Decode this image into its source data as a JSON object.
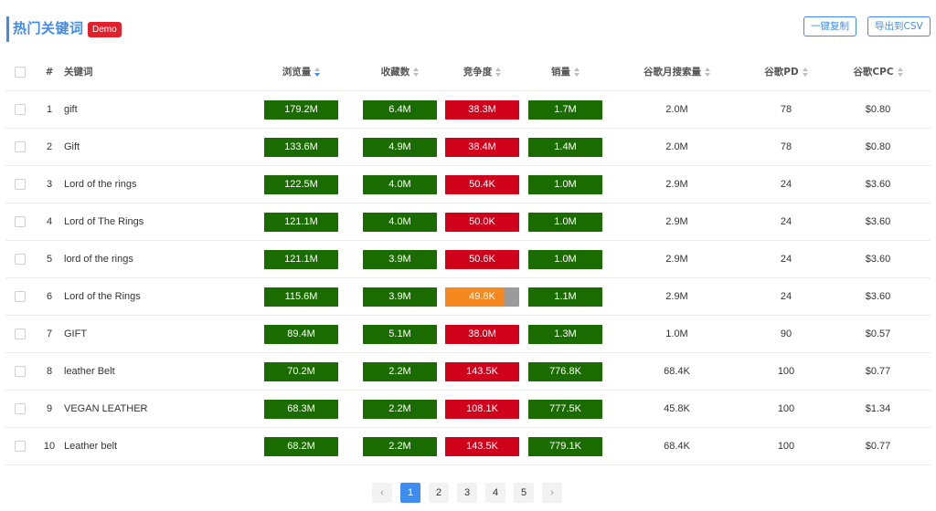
{
  "header": {
    "title": "热门关键词",
    "badge": "Demo",
    "copy_button": "一键复制",
    "export_button": "导出到CSV"
  },
  "columns": {
    "index": "#",
    "keyword": "关键词",
    "views": "浏览量",
    "favorites": "收藏数",
    "competition": "竞争度",
    "sales": "销量",
    "google_monthly": "谷歌月搜索量",
    "google_pd": "谷歌PD",
    "google_cpc": "谷歌CPC"
  },
  "colors": {
    "green": "#1a6b00",
    "red": "#d0021b",
    "orange": "#f5891f",
    "gray": "#9b9b9b",
    "accent": "#3f8cf0"
  },
  "rows": [
    {
      "index": "1",
      "keyword": "gift",
      "views": "179.2M",
      "favorites": "6.4M",
      "competition": "38.3M",
      "competition_color": "red",
      "competition_fill": 1,
      "sales": "1.7M",
      "google_monthly": "2.0M",
      "google_pd": "78",
      "google_cpc": "$0.80"
    },
    {
      "index": "2",
      "keyword": "Gift",
      "views": "133.6M",
      "favorites": "4.9M",
      "competition": "38.4M",
      "competition_color": "red",
      "competition_fill": 1,
      "sales": "1.4M",
      "google_monthly": "2.0M",
      "google_pd": "78",
      "google_cpc": "$0.80"
    },
    {
      "index": "3",
      "keyword": "Lord of the rings",
      "views": "122.5M",
      "favorites": "4.0M",
      "competition": "50.4K",
      "competition_color": "red",
      "competition_fill": 1,
      "sales": "1.0M",
      "google_monthly": "2.9M",
      "google_pd": "24",
      "google_cpc": "$3.60"
    },
    {
      "index": "4",
      "keyword": "Lord of The Rings",
      "views": "121.1M",
      "favorites": "4.0M",
      "competition": "50.0K",
      "competition_color": "red",
      "competition_fill": 1,
      "sales": "1.0M",
      "google_monthly": "2.9M",
      "google_pd": "24",
      "google_cpc": "$3.60"
    },
    {
      "index": "5",
      "keyword": "lord of the rings",
      "views": "121.1M",
      "favorites": "3.9M",
      "competition": "50.6K",
      "competition_color": "red",
      "competition_fill": 1,
      "sales": "1.0M",
      "google_monthly": "2.9M",
      "google_pd": "24",
      "google_cpc": "$3.60"
    },
    {
      "index": "6",
      "keyword": "Lord of the Rings",
      "views": "115.6M",
      "favorites": "3.9M",
      "competition": "49.8K",
      "competition_color": "orange",
      "competition_fill": 0.8,
      "sales": "1.1M",
      "google_monthly": "2.9M",
      "google_pd": "24",
      "google_cpc": "$3.60"
    },
    {
      "index": "7",
      "keyword": "GIFT",
      "views": "89.4M",
      "favorites": "5.1M",
      "competition": "38.0M",
      "competition_color": "red",
      "competition_fill": 1,
      "sales": "1.3M",
      "google_monthly": "1.0M",
      "google_pd": "90",
      "google_cpc": "$0.57"
    },
    {
      "index": "8",
      "keyword": "leather Belt",
      "views": "70.2M",
      "favorites": "2.2M",
      "competition": "143.5K",
      "competition_color": "red",
      "competition_fill": 1,
      "sales": "776.8K",
      "google_monthly": "68.4K",
      "google_pd": "100",
      "google_cpc": "$0.77"
    },
    {
      "index": "9",
      "keyword": "VEGAN LEATHER",
      "views": "68.3M",
      "favorites": "2.2M",
      "competition": "108.1K",
      "competition_color": "red",
      "competition_fill": 1,
      "sales": "777.5K",
      "google_monthly": "45.8K",
      "google_pd": "100",
      "google_cpc": "$1.34"
    },
    {
      "index": "10",
      "keyword": "Leather belt",
      "views": "68.2M",
      "favorites": "2.2M",
      "competition": "143.5K",
      "competition_color": "red",
      "competition_fill": 1,
      "sales": "779.1K",
      "google_monthly": "68.4K",
      "google_pd": "100",
      "google_cpc": "$0.77"
    }
  ],
  "pagination": {
    "prev": "‹",
    "next": "›",
    "pages": [
      "1",
      "2",
      "3",
      "4",
      "5"
    ],
    "current": "1"
  }
}
